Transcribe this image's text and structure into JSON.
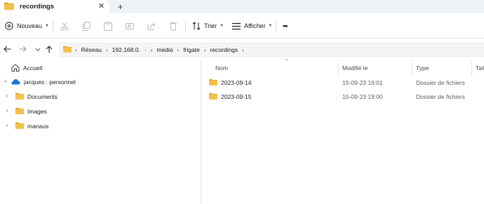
{
  "window": {
    "tab_title": "recordings",
    "tab_close_glyph": "✕",
    "new_tab_glyph": "+"
  },
  "toolbar": {
    "new_label": "Nouveau",
    "sort_label": "Trier",
    "view_label": "Afficher",
    "more_glyph": "•••",
    "icons": [
      "plus-circle-icon",
      "cut-icon",
      "copy-icon",
      "paste-icon",
      "rename-icon",
      "share-icon",
      "delete-icon",
      "sort-icon",
      "view-icon",
      "more-icon"
    ]
  },
  "address": {
    "crumbs": [
      "Réseau",
      "192.168.0.",
      "·",
      "media",
      "frigate",
      "recordings"
    ],
    "chevron_glyph": "›"
  },
  "navpane": {
    "items": [
      {
        "label": "Accueil",
        "icon": "home-icon"
      },
      {
        "label": "jacques : personnel",
        "icon": "onedrive-cloud-icon",
        "expanded": true
      },
      {
        "label": "Documents",
        "icon": "folder-icon"
      },
      {
        "label": "Images",
        "icon": "folder-icon"
      },
      {
        "label": "manaus",
        "icon": "folder-icon"
      }
    ],
    "expand_open_glyph": "⌄",
    "expand_closed_glyph": "›"
  },
  "filelist": {
    "columns": {
      "name": "Nom",
      "modified": "Modifié le",
      "type": "Type",
      "size": "Tail"
    },
    "sort_glyph": "^",
    "rows": [
      {
        "name": "2023-09-14",
        "modified": "15-09-23 19:01",
        "type": "Dossier de fichiers"
      },
      {
        "name": "2023-09-15",
        "modified": "15-09-23 19:00",
        "type": "Dossier de fichiers"
      }
    ]
  },
  "colors": {
    "folder_yellow": "#f4c24a",
    "folder_yellow_dark": "#e3a72b",
    "onedrive_blue": "#1a73d9",
    "tabstrip_bg": "#eef1f6"
  }
}
